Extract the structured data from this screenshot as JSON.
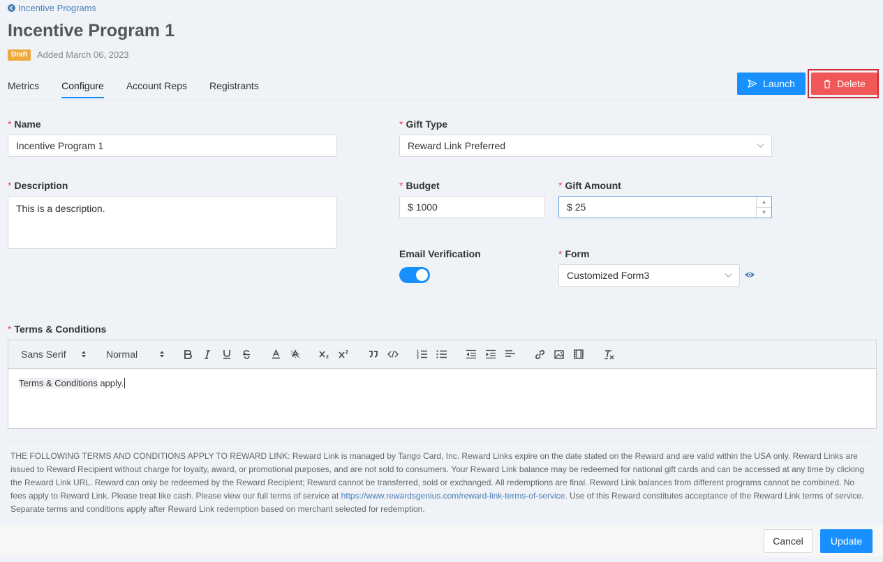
{
  "breadcrumb": {
    "back_label": "Incentive Programs"
  },
  "page": {
    "title": "Incentive Program 1",
    "status_badge": "Draft",
    "added_text": "Added March 06, 2023"
  },
  "tabs": [
    {
      "label": "Metrics",
      "active": false
    },
    {
      "label": "Configure",
      "active": true
    },
    {
      "label": "Account Reps",
      "active": false
    },
    {
      "label": "Registrants",
      "active": false
    }
  ],
  "actions": {
    "launch_label": "Launch",
    "delete_label": "Delete"
  },
  "form": {
    "required_marker": "*",
    "name": {
      "label": "Name",
      "value": "Incentive Program 1"
    },
    "gift_type": {
      "label": "Gift Type",
      "value": "Reward Link Preferred"
    },
    "description": {
      "label": "Description",
      "value": "This is a description."
    },
    "budget": {
      "label": "Budget",
      "prefix": "$",
      "value": "1000"
    },
    "gift_amount": {
      "label": "Gift Amount",
      "prefix": "$",
      "value": "25"
    },
    "email_verification": {
      "label": "Email Verification",
      "enabled": true
    },
    "form_select": {
      "label": "Form",
      "value": "Customized Form3"
    },
    "terms": {
      "label": "Terms & Conditions"
    }
  },
  "editor": {
    "font_picker": "Sans Serif",
    "size_picker": "Normal",
    "content_highlight": "Terms & Conditions",
    "content_rest": " apply."
  },
  "terms_text": {
    "part1": "THE FOLLOWING TERMS AND CONDITIONS APPLY TO REWARD LINK: Reward Link is managed by Tango Card, Inc. Reward Links expire on the date stated on the Reward and are valid within the USA only. Reward Links are issued to Reward Recipient without charge for loyalty, award, or promotional purposes, and are not sold to consumers. Your Reward Link balance may be redeemed for national gift cards and can be accessed at any time by clicking the Reward Link URL. Reward can only be redeemed by the Reward Recipient; Reward cannot be transferred, sold or exchanged. All redemptions are final. Reward Link balances from different programs cannot be combined. No fees apply to Reward Link. Please treat like cash. Please view our full terms of service at ",
    "link": "https://www.rewardsgenius.com/reward-link-terms-of-service",
    "part2": ". Use of this Reward constitutes acceptance of the Reward Link terms of service. Separate terms and conditions apply after Reward Link redemption based on merchant selected for redemption."
  },
  "footer": {
    "cancel_label": "Cancel",
    "update_label": "Update"
  },
  "colors": {
    "primary": "#1890ff",
    "danger": "#f25757",
    "draft": "#f0a93a",
    "required": "#e5484d"
  }
}
